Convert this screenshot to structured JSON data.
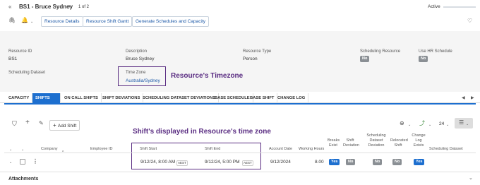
{
  "header": {
    "title": "BS1 - Bruce Sydney",
    "pager": "1 of 2",
    "status": "Active"
  },
  "toolbar": {
    "btn_details": "Resource Details",
    "btn_gantt": "Resource Shift Gantt",
    "btn_generate": "Generate Schedules and Capacity"
  },
  "fields": {
    "resource_id_label": "Resource ID",
    "resource_id": "BS1",
    "description_label": "Description",
    "description": "Bruce Sydney",
    "resource_type_label": "Resource Type",
    "resource_type": "Person",
    "scheduling_resource_label": "Scheduling Resource",
    "scheduling_resource": "No",
    "use_hr_label": "Use HR Schedule",
    "use_hr": "No",
    "scheduling_dataset_label": "Scheduling Dataset",
    "time_zone_label": "Time Zone",
    "time_zone": "Australia/Sydney"
  },
  "annotations": {
    "resource_tz": "Resource's Timezone",
    "shift_tz": "Shift's displayed in Resource's time zone"
  },
  "tabs": [
    "CAPACITY",
    "SHIFTS",
    "ON CALL SHIFTS",
    "SHIFT DEVIATIONS",
    "SCHEDULING DATASET DEVIATIONS",
    "BASE SCHEDULE",
    "BASE SHIFT",
    "CHANGE LOG"
  ],
  "grid_toolbar": {
    "add_shift": "Add Shift",
    "page_size": "24"
  },
  "columns": {
    "company": "Company",
    "employee_id": "Employee ID",
    "shift_start": "Shift Start",
    "shift_end": "Shift End",
    "account_date": "Account Date",
    "working_hours": "Working Hours",
    "breaks_exist": "Breaks Exist",
    "shift_deviation": "Shift Deviation",
    "scheduling_dataset_deviation": "Scheduling Dataset Deviation",
    "relocated_shift": "Relocated Shift",
    "change_log_exists": "Change Log Exists",
    "scheduling_dataset": "Scheduling Dataset"
  },
  "row": {
    "shift_start": "9/12/24, 8:00 AM",
    "shift_start_tz": "AEST",
    "shift_end": "9/12/24, 5:00 PM",
    "shift_end_tz": "AEST",
    "account_date": "9/12/2024",
    "working_hours": "8.00",
    "breaks_exist": "Yes",
    "shift_deviation": "No",
    "scheduling_dataset_deviation": "No",
    "relocated_shift": "No",
    "change_log_exists": "Yes"
  },
  "attachments": "Attachments"
}
